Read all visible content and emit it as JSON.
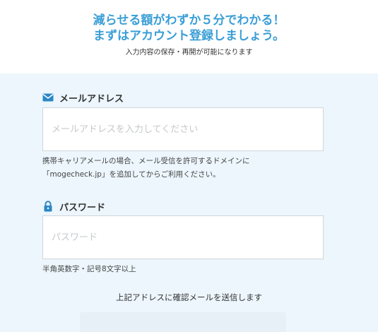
{
  "hero": {
    "headline_line1": "減らせる額がわずか５分でわかる！",
    "headline_line2": "まずはアカウント登録しましょう。",
    "subtext": "入力内容の保存・再開が可能になります",
    "accent_color": "#3a9ed6"
  },
  "form": {
    "background_color": "#ecf6fc",
    "email": {
      "icon": "mail-icon",
      "label": "メールアドレス",
      "placeholder": "メールアドレスを入力してください",
      "value": "",
      "help_line1": "携帯キャリアメールの場合、メール受信を許可するドメインに",
      "help_line2": "「mogecheck.jp」を追加してからご利用ください。"
    },
    "password": {
      "icon": "lock-icon",
      "label": "パスワード",
      "placeholder": "パスワード",
      "value": "",
      "help": "半角英数字・記号8文字以上"
    },
    "confirm_note": "上記アドレスに確認メールを送信します"
  }
}
